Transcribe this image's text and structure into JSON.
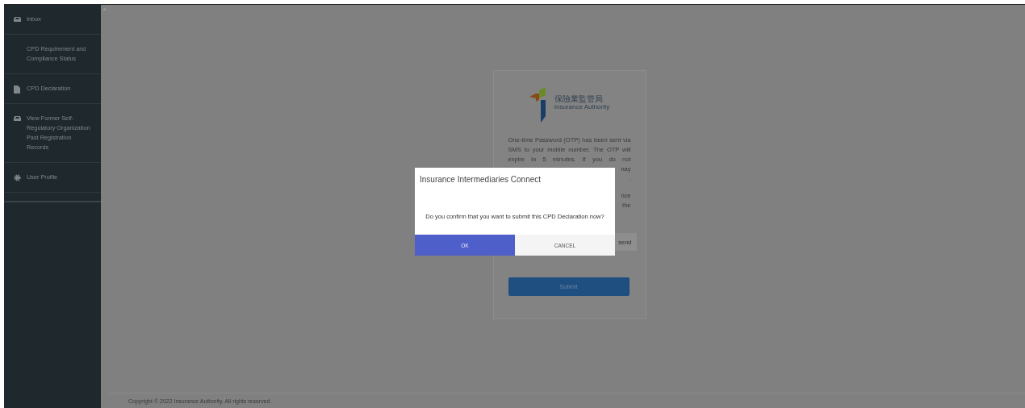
{
  "sidebar": {
    "items": [
      {
        "kind": "inbox",
        "label": "Inbox"
      },
      {
        "kind": "none",
        "label": "CPD Requirement and Compliance Status"
      },
      {
        "kind": "document",
        "label": "CPD Declaration"
      },
      {
        "kind": "inbox",
        "label": "View Former Self-Regulatory Organization Past Registration Records"
      },
      {
        "kind": "gear",
        "label": "User Profile"
      }
    ]
  },
  "card": {
    "logo": {
      "chinese": "保險業監管局",
      "english": "Insurance Authority"
    },
    "paragraph_1": "One-time Password (OTP) has been sent via SMS to your mobile number. The OTP will expire in 5 minutes. If you do not",
    "paragraph_1_fragments": [
      "nay",
      "."
    ],
    "paragraph_2_fragments": [
      "nce",
      "the"
    ],
    "resend_button": "send",
    "submit_button": "Submit"
  },
  "dialog": {
    "title": "Insurance Intermediaries Connect",
    "message": "Do you confirm that you want to submit this CPD Declaration now?",
    "buttons": [
      {
        "label": "OK",
        "kind": "primary"
      },
      {
        "label": "CANCEL",
        "kind": "secondary"
      }
    ]
  },
  "footer": "Copyright © 2022 Insurance Authority. All rights reserved."
}
